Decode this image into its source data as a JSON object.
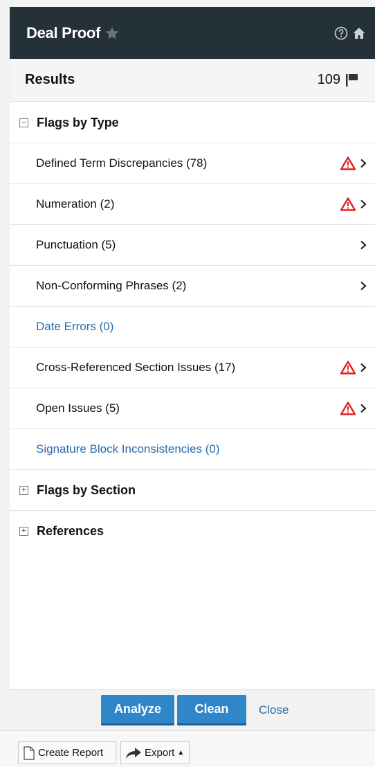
{
  "header": {
    "title": "Deal Proof",
    "icons": [
      "star-icon",
      "help-icon",
      "home-icon"
    ]
  },
  "results": {
    "label": "Results",
    "count": "109"
  },
  "sections": {
    "flags_by_type": {
      "label": "Flags by Type",
      "toggle": "−"
    },
    "flags_by_section": {
      "label": "Flags by Section",
      "toggle": "+"
    },
    "references": {
      "label": "References",
      "toggle": "+"
    }
  },
  "items": [
    {
      "label": "Defined Term Discrepancies (78)",
      "warning": true,
      "arrow": true,
      "link": false
    },
    {
      "label": "Numeration (2)",
      "warning": true,
      "arrow": true,
      "link": false
    },
    {
      "label": "Punctuation (5)",
      "warning": false,
      "arrow": true,
      "link": false
    },
    {
      "label": "Non-Conforming Phrases (2)",
      "warning": false,
      "arrow": true,
      "link": false
    },
    {
      "label": "Date Errors (0)",
      "warning": false,
      "arrow": false,
      "link": true
    },
    {
      "label": "Cross-Referenced Section Issues (17)",
      "warning": true,
      "arrow": true,
      "link": false
    },
    {
      "label": "Open Issues (5)",
      "warning": true,
      "arrow": true,
      "link": false
    },
    {
      "label": "Signature Block Inconsistencies (0)",
      "warning": false,
      "arrow": false,
      "link": true
    }
  ],
  "actions": {
    "analyze": "Analyze",
    "clean": "Clean",
    "close": "Close"
  },
  "footer": {
    "create_report": "Create Report",
    "export": "Export"
  },
  "colors": {
    "header_bg": "#253139",
    "button_blue": "#2f86c8",
    "link_blue": "#2c6ba8",
    "warning_red": "#e02020"
  }
}
